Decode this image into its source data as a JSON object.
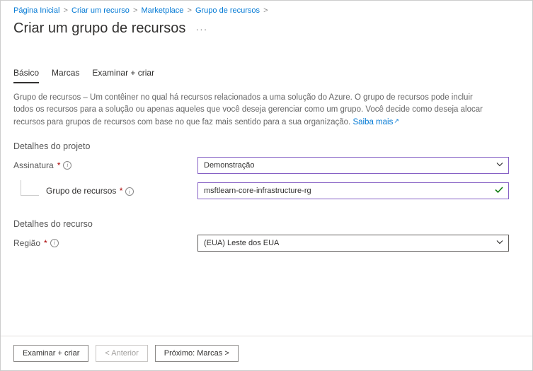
{
  "breadcrumb": {
    "home": "Página Inicial",
    "create": "Criar um recurso",
    "marketplace": "Marketplace",
    "rg": "Grupo de recursos"
  },
  "title": "Criar um grupo de recursos",
  "tabs": {
    "basic": "Básico",
    "tags": "Marcas",
    "review": "Examinar + criar"
  },
  "description": {
    "text": "Grupo de recursos – Um contêiner no qual há recursos relacionados a uma solução do Azure. O grupo de recursos pode incluir todos os recursos para a solução ou apenas aqueles que você deseja gerenciar como um grupo. Você decide como deseja alocar recursos para grupos de recursos com base no que faz mais sentido para a sua organização. ",
    "learn_more": "Saiba mais"
  },
  "sections": {
    "project": "Detalhes do projeto",
    "resource": "Detalhes do recurso"
  },
  "fields": {
    "subscription": {
      "label": "Assinatura",
      "value": "Demonstração"
    },
    "resource_group": {
      "label": "Grupo de recursos",
      "value": "msftlearn-core-infrastructure-rg"
    },
    "region": {
      "label": "Região",
      "value": "(EUA) Leste dos EUA"
    }
  },
  "footer": {
    "review": "Examinar + criar",
    "previous": "< Anterior",
    "next": "Próximo: Marcas >"
  }
}
